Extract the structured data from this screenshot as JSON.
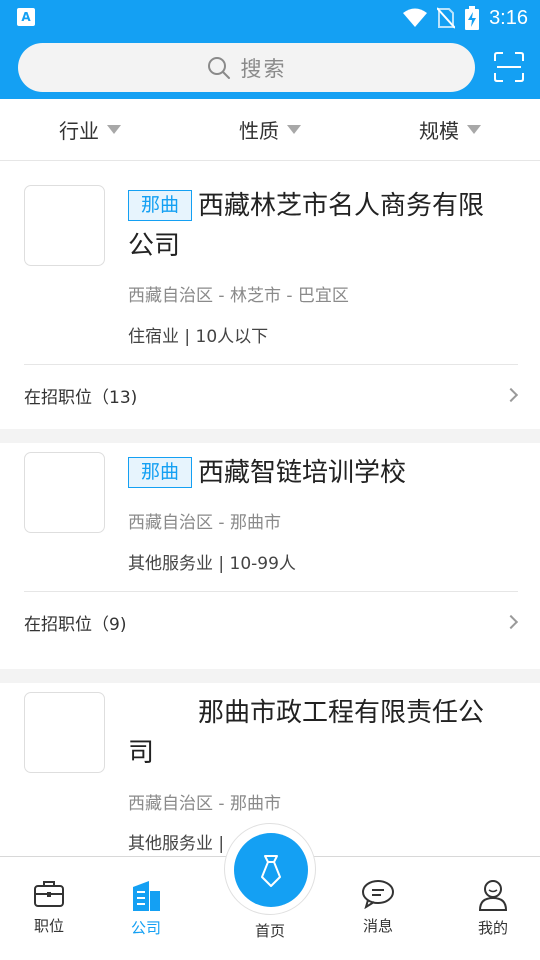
{
  "status_bar": {
    "time": "3:16"
  },
  "search": {
    "placeholder": "搜索"
  },
  "filters": [
    {
      "label": "行业"
    },
    {
      "label": "性质"
    },
    {
      "label": "规模"
    }
  ],
  "companies": [
    {
      "tag": "那曲",
      "name": "西藏林芝市名人商务有限公司",
      "location": "西藏自治区 - 林芝市 - 巴宜区",
      "meta": "住宿业 | 10人以下",
      "jobs_label": "在招职位（13)"
    },
    {
      "tag": "那曲",
      "name": "西藏智链培训学校",
      "location": "西藏自治区 - 那曲市",
      "meta": "其他服务业 | 10-99人",
      "jobs_label": "在招职位（9)"
    },
    {
      "tag": "",
      "name": "那曲市政工程有限责任公司",
      "location": "西藏自治区 - 那曲市",
      "meta": "其他服务业 |"
    }
  ],
  "tabs": [
    {
      "label": "职位",
      "icon": "briefcase-icon"
    },
    {
      "label": "公司",
      "icon": "building-icon",
      "active": true
    },
    {
      "label": "首页",
      "icon": "tie-icon"
    },
    {
      "label": "消息",
      "icon": "chat-icon"
    },
    {
      "label": "我的",
      "icon": "person-icon"
    }
  ],
  "colors": {
    "accent": "#14a0f3",
    "background_gap": "#f3f3f3"
  }
}
